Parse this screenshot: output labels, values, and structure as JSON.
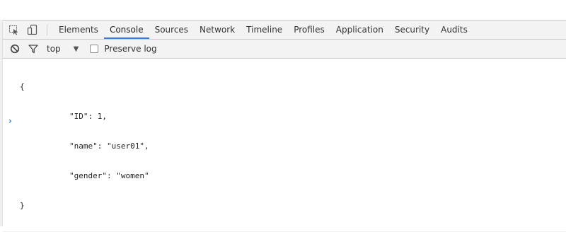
{
  "tabs": [
    {
      "label": "Elements"
    },
    {
      "label": "Console"
    },
    {
      "label": "Sources"
    },
    {
      "label": "Network"
    },
    {
      "label": "Timeline"
    },
    {
      "label": "Profiles"
    },
    {
      "label": "Application"
    },
    {
      "label": "Security"
    },
    {
      "label": "Audits"
    }
  ],
  "active_tab": "Console",
  "toolbar": {
    "context": "top",
    "preserve_log_label": "Preserve log",
    "preserve_log_checked": false
  },
  "console": {
    "lines": [
      "{",
      "\"ID\": 1,",
      "\"name\": \"user01\",",
      "\"gender\": \"women\"",
      "}"
    ],
    "prompt_symbol": "›"
  },
  "colors": {
    "accent": "#3879d9",
    "prompt": "#367cf1",
    "toolbar_bg": "#f3f3f3"
  },
  "icons": [
    "inspect-element-icon",
    "device-mode-icon",
    "clear-console-icon",
    "filter-icon",
    "dropdown-arrow-icon"
  ]
}
